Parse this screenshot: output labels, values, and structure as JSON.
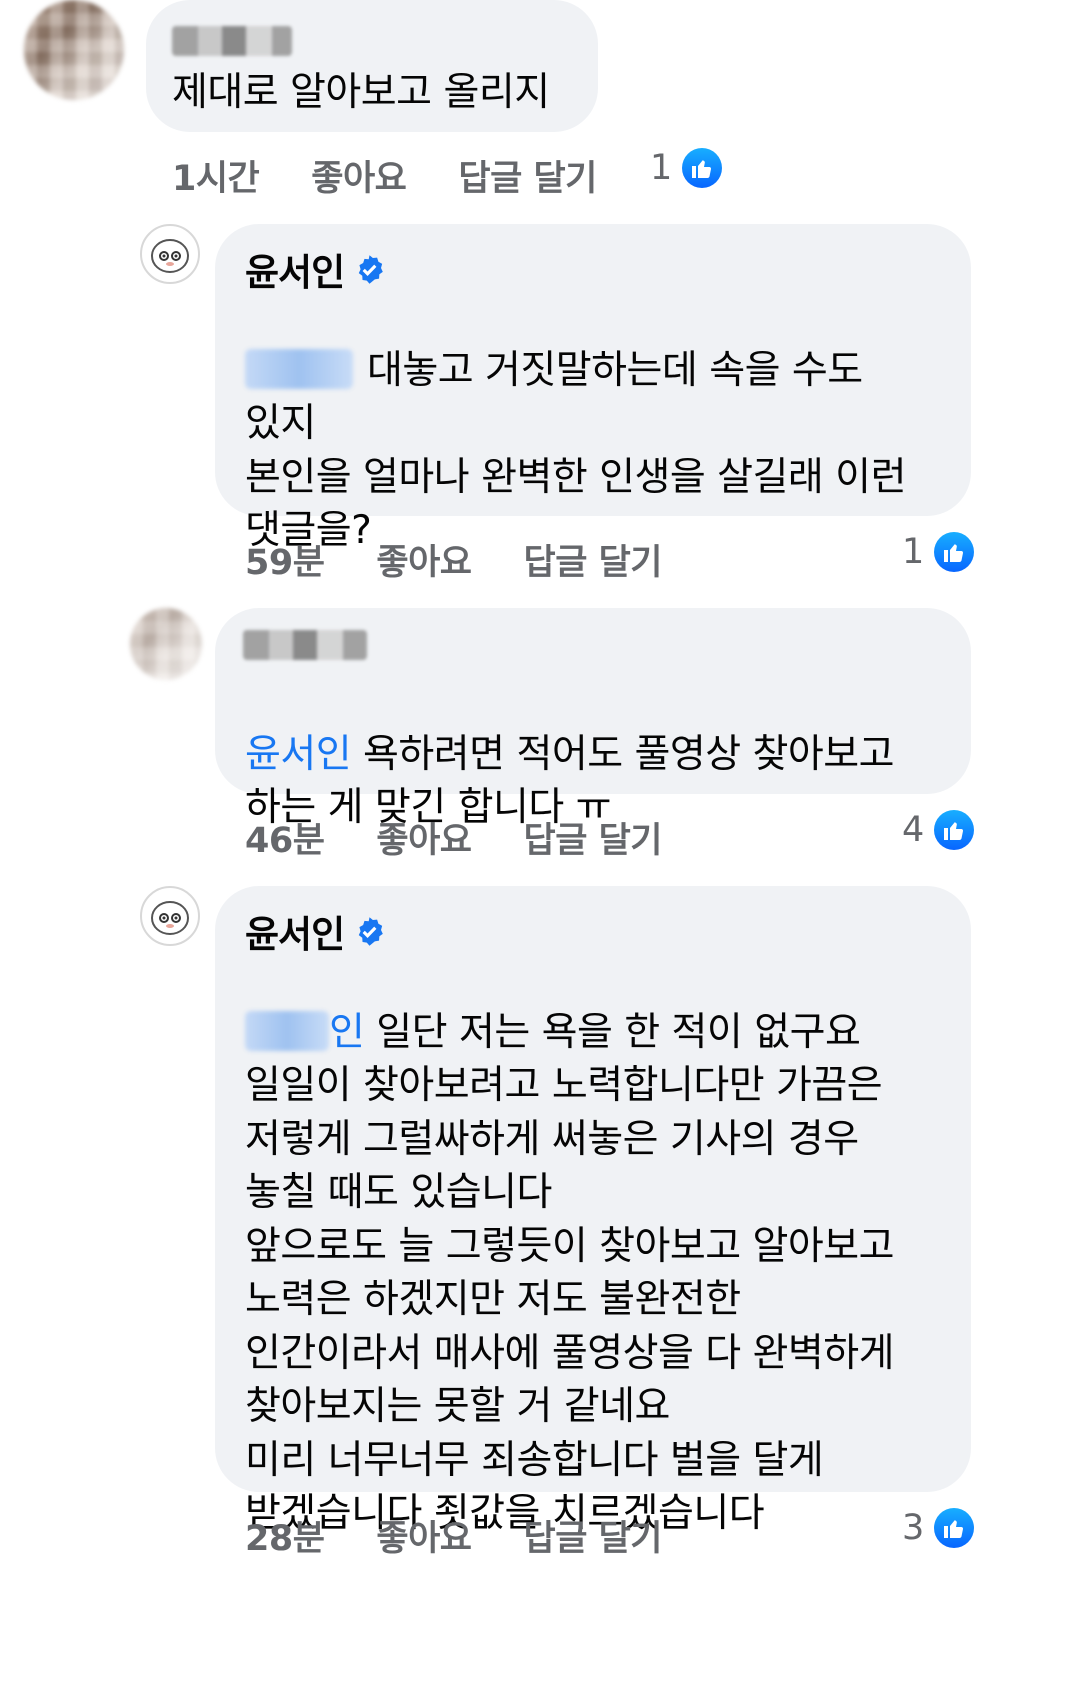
{
  "comments": [
    {
      "author": "",
      "text": "제대로 알아보고 올리지",
      "time": "1시간",
      "like_label": "좋아요",
      "reply_label": "답글 달기",
      "reactions": "1"
    },
    {
      "author": "윤서인",
      "text_after_mention": "대놓고 거짓말하는데 속을 수도\n있지\n본인을 얼마나 완벽한 인생을 살길래 이런\n댓글을?",
      "time": "59분",
      "like_label": "좋아요",
      "reply_label": "답글 달기",
      "reactions": "1"
    },
    {
      "author": "",
      "mention": "윤서인",
      "text_after_mention": " 욕하려면 적어도 풀영상 찾아보고\n하는 게 맞긴 합니다 ㅠ",
      "time": "46분",
      "like_label": "좋아요",
      "reply_label": "답글 달기",
      "reactions": "4"
    },
    {
      "author": "윤서인",
      "mention_tail": "인",
      "text_after_mention": " 일단 저는 욕을 한 적이 없구요\n일일이 찾아보려고 노력합니다만 가끔은\n저렇게 그럴싸하게 써놓은 기사의 경우\n놓칠 때도 있습니다\n앞으로도 늘 그렇듯이 찾아보고 알아보고\n노력은 하겠지만 저도 불완전한\n인간이라서 매사에 풀영상을 다 완벽하게\n찾아보지는 못할 거 같네요\n미리 너무너무 죄송합니다 벌을 달게\n받겠습니다 죗값을 치르겠습니다",
      "time": "28분",
      "like_label": "좋아요",
      "reply_label": "답글 달기",
      "reactions": "3"
    }
  ],
  "colors": {
    "bubble": "#f0f2f5",
    "meta_text": "#65676b",
    "link": "#1877f2",
    "like_badge": "#0866ff"
  },
  "icons": {
    "verified": "verified-badge-icon",
    "like": "thumbs-up-icon"
  }
}
